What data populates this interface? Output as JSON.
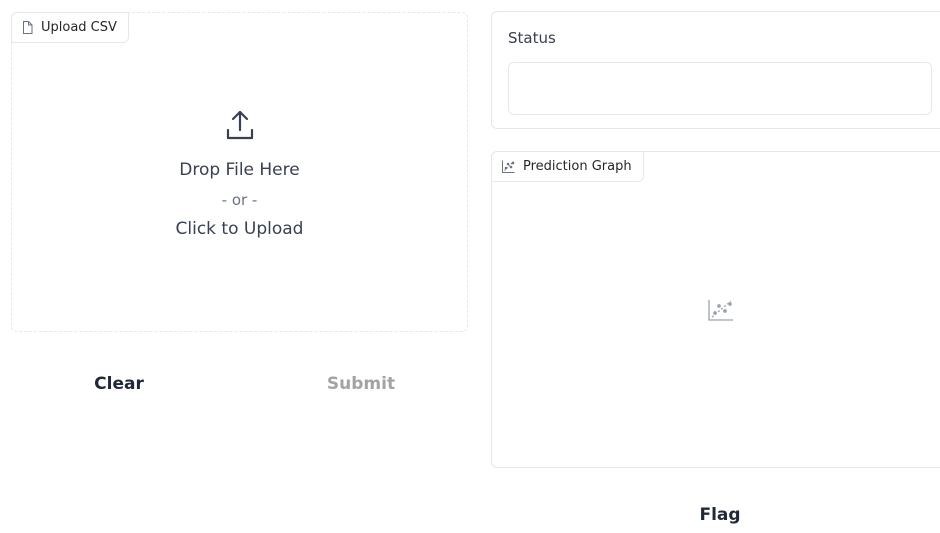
{
  "upload": {
    "tab_label": "Upload CSV",
    "drop_text": "Drop File Here",
    "or_text": "- or -",
    "click_text": "Click to Upload",
    "tab_icon": "file-icon",
    "icon": "upload-icon"
  },
  "actions": {
    "clear_label": "Clear",
    "submit_label": "Submit",
    "flag_label": "Flag"
  },
  "status": {
    "label": "Status",
    "value": ""
  },
  "graph": {
    "tab_label": "Prediction Graph",
    "tab_icon": "scatter-plot-icon",
    "placeholder_icon": "scatter-plot-icon"
  },
  "colors": {
    "border": "#e5e7eb",
    "text": "#1f2937",
    "disabled": "#a3a3a3"
  }
}
